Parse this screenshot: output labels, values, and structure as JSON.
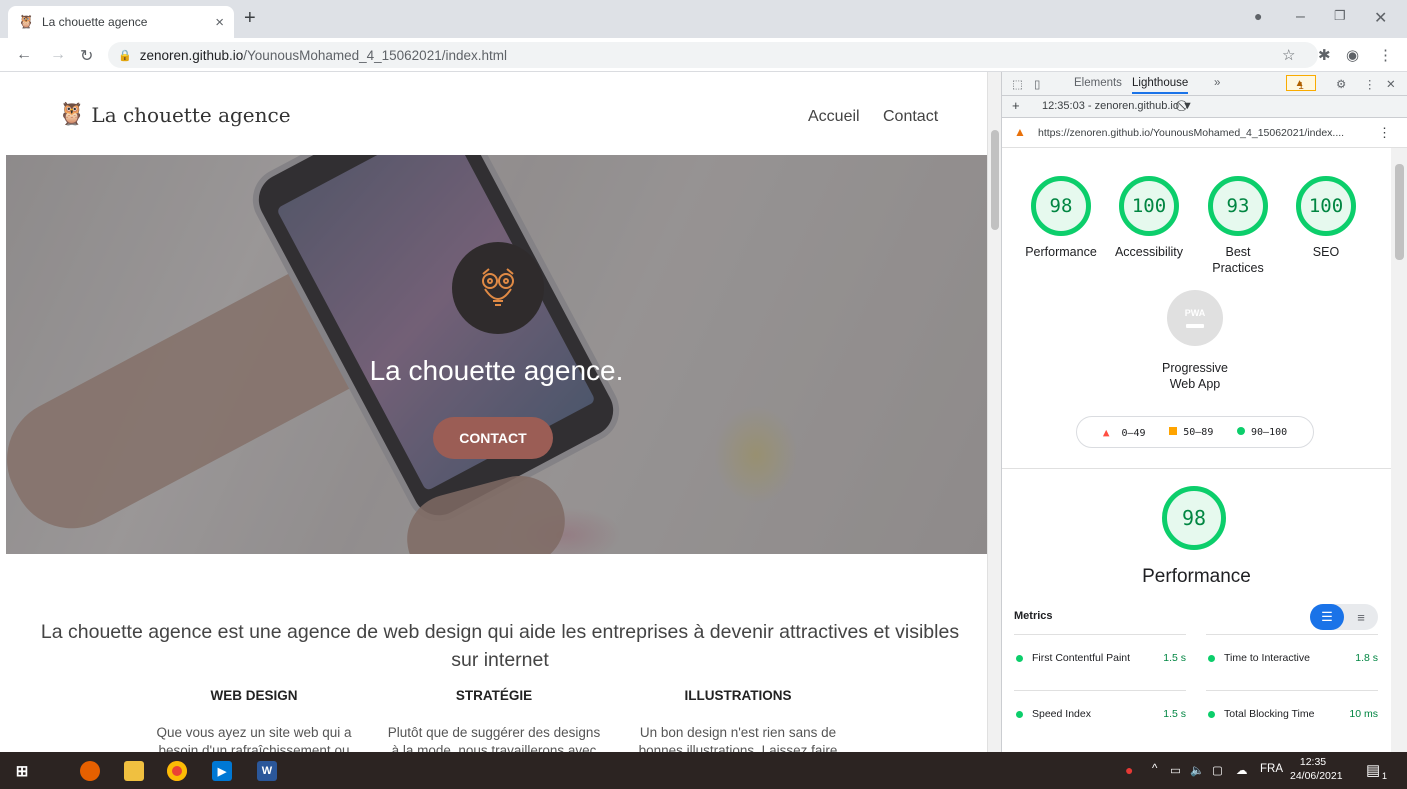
{
  "browser": {
    "tab_title": "La chouette agence",
    "tab_close": "×",
    "new_tab": "+",
    "url_host": "zenoren.github.io",
    "url_path": "/YounousMohamed_4_15062021/index.html"
  },
  "page": {
    "logo_text": "La chouette agence",
    "nav": [
      "Accueil",
      "Contact"
    ],
    "hero_title": "La chouette agence.",
    "hero_button": "CONTACT",
    "intro": "La chouette agence est une agence de web design qui aide les entreprises à devenir attractives et visibles sur internet",
    "columns": [
      {
        "title": "WEB DESIGN",
        "text": "Que vous ayez un site web qui a besoin d'un rafraîchissement ou"
      },
      {
        "title": "STRATÉGIE",
        "text": "Plutôt que de suggérer des designs à la mode, nous travaillerons avec"
      },
      {
        "title": "ILLUSTRATIONS",
        "text": "Un bon design n'est rien sans de bonnes illustrations. Laissez faire"
      }
    ]
  },
  "devtools": {
    "tabs": [
      "Elements",
      "Lighthouse",
      "»"
    ],
    "active_tab": "Lighthouse",
    "warning_count": "1",
    "report_selector": "12:35:03 - zenoren.github.io ▼",
    "report_url": "https://zenoren.github.io/YounousMohamed_4_15062021/index....",
    "scores": [
      {
        "value": "98",
        "label": "Performance"
      },
      {
        "value": "100",
        "label": "Accessibility"
      },
      {
        "value": "93",
        "label": "Best Practices"
      },
      {
        "value": "100",
        "label": "SEO"
      }
    ],
    "pwa_badge": "PWA",
    "pwa_label": "Progressive Web App",
    "legend": [
      "0–49",
      "50–89",
      "90–100"
    ],
    "perf_score": "98",
    "perf_title": "Performance",
    "metrics_title": "Metrics",
    "metrics": [
      {
        "name": "First Contentful Paint",
        "value": "1.5 s"
      },
      {
        "name": "Time to Interactive",
        "value": "1.8 s"
      },
      {
        "name": "Speed Index",
        "value": "1.5 s"
      },
      {
        "name": "Total Blocking Time",
        "value": "10 ms"
      }
    ],
    "colors": {
      "pass": "#0cce6b",
      "average": "#ffa400",
      "fail": "#ff4e42",
      "accent": "#1a73e8"
    }
  },
  "taskbar": {
    "language": "FRA",
    "time": "12:35",
    "date": "24/06/2021",
    "notification_count": "1"
  }
}
